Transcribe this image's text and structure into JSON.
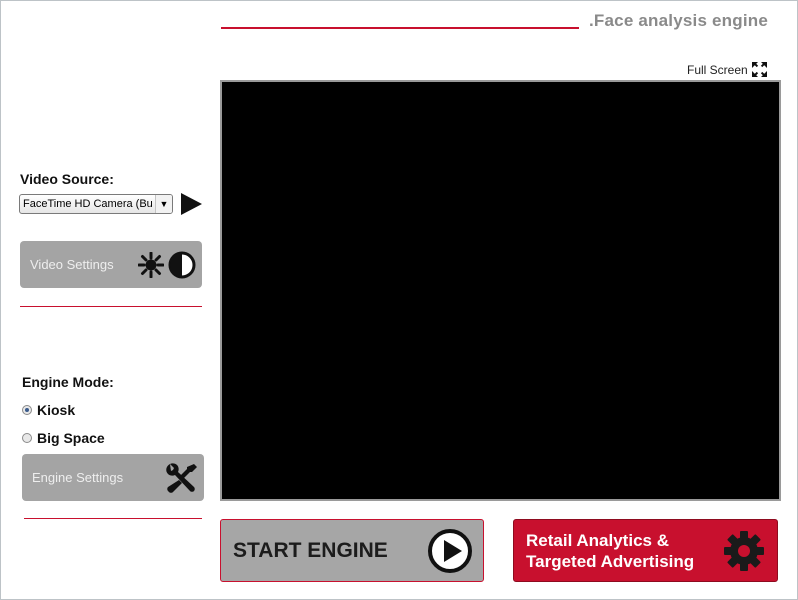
{
  "header": {
    "title": ".Face analysis engine",
    "fullscreen_label": "Full Screen"
  },
  "video_source": {
    "label": "Video Source:",
    "selected": "FaceTime HD Camera (Bu",
    "settings_button": "Video Settings"
  },
  "engine_mode": {
    "label": "Engine Mode:",
    "options": [
      {
        "label": "Kiosk",
        "checked": true
      },
      {
        "label": "Big Space",
        "checked": false
      }
    ],
    "settings_button": "Engine Settings"
  },
  "actions": {
    "start_label": "START ENGINE",
    "retail_line1": "Retail Analytics &",
    "retail_line2": "Targeted Advertising"
  },
  "icons": [
    "fullscreen-icon",
    "play-icon",
    "brightness-icon",
    "contrast-icon",
    "wrench-screwdriver-icon",
    "play-circle-icon",
    "gear-icon"
  ],
  "colors": {
    "accent": "#c8102e",
    "button_gray": "#a4a4a4",
    "video_bg": "#000000"
  }
}
